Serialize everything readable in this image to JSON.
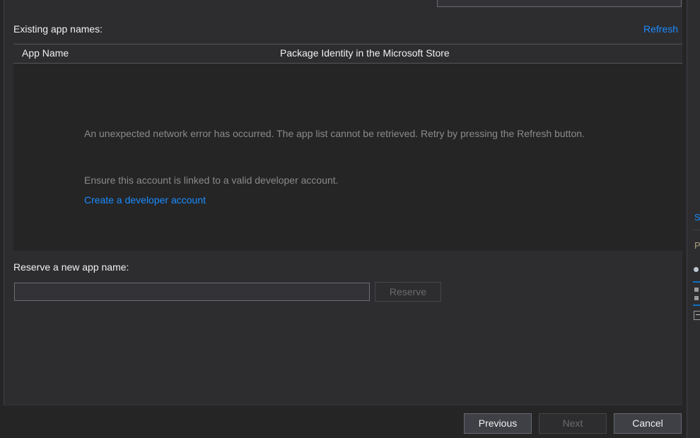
{
  "dialog": {
    "existing_label": "Existing app names:",
    "refresh_label": "Refresh",
    "reserve_label": "Reserve a new app name:"
  },
  "applist": {
    "columns": {
      "app_name": "App Name",
      "package_identity": "Package Identity in the Microsoft Store"
    },
    "rows": [],
    "empty_state": {
      "network_error": "An unexpected network error has occurred. The app list cannot be retrieved. Retry by pressing the Refresh button.",
      "ensure_account": "Ensure this account is linked to a valid developer account.",
      "create_account_link": "Create a developer account"
    }
  },
  "reserve": {
    "input_value": "",
    "input_placeholder": "",
    "button_label": "Reserve"
  },
  "footer": {
    "previous_label": "Previous",
    "next_label": "Next",
    "cancel_label": "Cancel"
  },
  "right_panel": {
    "link_fragment": "S",
    "header_fragment": "P"
  },
  "colors": {
    "page_background": "#2d2d30",
    "list_background": "#252526",
    "accent_link": "#1a8cff",
    "muted_text": "#8a8a8a",
    "primary_text": "#f1f1f1",
    "disabled_text": "#6b6b6b",
    "border": "#555559"
  }
}
